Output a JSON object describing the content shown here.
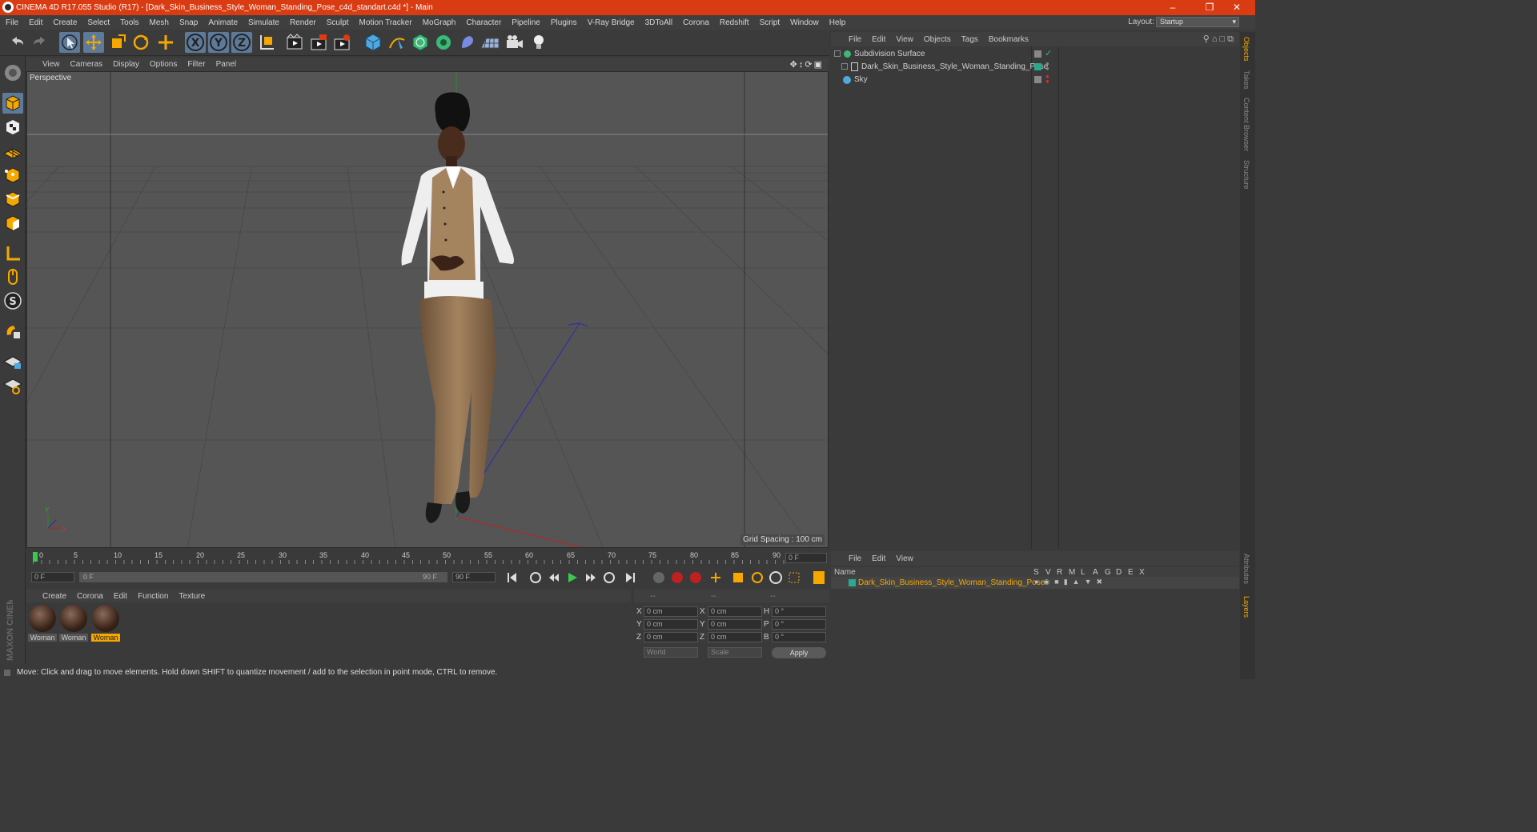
{
  "titlebar": {
    "title": "CINEMA 4D R17.055 Studio (R17) - [Dark_Skin_Business_Style_Woman_Standing_Pose_c4d_standart.c4d *] - Main",
    "minimize": "–",
    "restore": "❐",
    "close": "✕"
  },
  "menu": [
    "File",
    "Edit",
    "Create",
    "Select",
    "Tools",
    "Mesh",
    "Snap",
    "Animate",
    "Simulate",
    "Render",
    "Sculpt",
    "Motion Tracker",
    "MoGraph",
    "Character",
    "Pipeline",
    "Plugins",
    "V-Ray Bridge",
    "3DToAll",
    "Corona",
    "Redshift",
    "Script",
    "Window",
    "Help"
  ],
  "layout": {
    "label": "Layout:",
    "value": "Startup"
  },
  "viewport": {
    "menu": [
      "View",
      "Cameras",
      "Display",
      "Options",
      "Filter",
      "Panel"
    ],
    "label": "Perspective",
    "grid_spacing": "Grid Spacing : 100 cm",
    "axis_y": "Y",
    "axis_x": "X"
  },
  "objects": {
    "menu": [
      "File",
      "Edit",
      "View",
      "Objects",
      "Tags",
      "Bookmarks"
    ],
    "rows": [
      {
        "name": "Subdivision Surface",
        "color": "#d0d0d0"
      },
      {
        "name": "Dark_Skin_Business_Style_Woman_Standing_Pose",
        "color": "#d0d0d0"
      },
      {
        "name": "Sky",
        "color": "#d0d0d0"
      }
    ]
  },
  "right_tabs": [
    "Objects",
    "Takes",
    "Content Browser",
    "Structure"
  ],
  "right_tabs_bottom": [
    "Attributes",
    "Layers"
  ],
  "timeline": {
    "ticks": [
      "0",
      "5",
      "10",
      "15",
      "20",
      "25",
      "30",
      "35",
      "40",
      "45",
      "50",
      "55",
      "60",
      "65",
      "70",
      "75",
      "80",
      "85",
      "90"
    ],
    "current_frame": "0 F",
    "start": "0 F",
    "range_start": "0 F",
    "range_end": "90 F",
    "end": "90 F"
  },
  "materials": {
    "menu": [
      "Create",
      "Corona",
      "Edit",
      "Function",
      "Texture"
    ],
    "items": [
      {
        "label": "Woman",
        "selected": false
      },
      {
        "label": "Woman",
        "selected": false
      },
      {
        "label": "Woman",
        "selected": true
      }
    ]
  },
  "coords": {
    "head": [
      "--",
      "--",
      "--"
    ],
    "rows": [
      {
        "a": "X",
        "av": "0 cm",
        "b": "X",
        "bv": "0 cm",
        "c": "H",
        "cv": "0 °"
      },
      {
        "a": "Y",
        "av": "0 cm",
        "b": "Y",
        "bv": "0 cm",
        "c": "P",
        "cv": "0 °"
      },
      {
        "a": "Z",
        "av": "0 cm",
        "b": "Z",
        "bv": "0 cm",
        "c": "B",
        "cv": "0 °"
      }
    ],
    "world": "World",
    "scale": "Scale",
    "apply": "Apply"
  },
  "layers": {
    "menu": [
      "File",
      "Edit",
      "View"
    ],
    "name_header": "Name",
    "flags": [
      "S",
      "V",
      "R",
      "M",
      "L",
      "A",
      "G",
      "D",
      "E",
      "X"
    ],
    "row": "Dark_Skin_Business_Style_Woman_Standing_Pose",
    "row_color": "#f6a800"
  },
  "status": "Move: Click and drag to move elements. Hold down SHIFT to quantize movement / add to the selection in point mode, CTRL to remove.",
  "brand": "MAXON CINEMA 4D"
}
